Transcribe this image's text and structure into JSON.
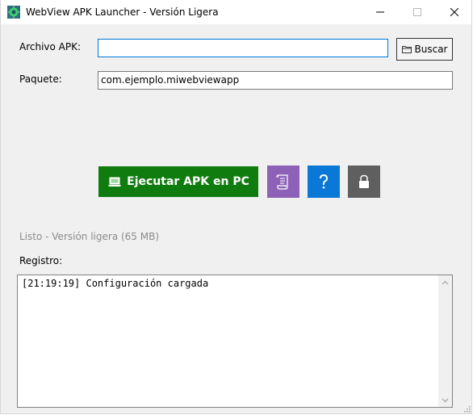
{
  "window": {
    "title": "WebView APK Launcher - Versión Ligera"
  },
  "form": {
    "apk_label": "Archivo APK:",
    "apk_value": "",
    "browse_label": "Buscar",
    "package_label": "Paquete:",
    "package_value": "com.ejemplo.miwebviewapp"
  },
  "actions": {
    "run_label": "Ejecutar APK en PC",
    "run_color": "#107c10",
    "log_button_color": "#8e61b8",
    "help_button_color": "#0a78d7",
    "lock_button_color": "#5f5f5f"
  },
  "status": {
    "text": "Listo - Versión ligera (65 MB)"
  },
  "log": {
    "label": "Registro:",
    "lines": "[21:19:19] Configuración cargada"
  },
  "icons": {
    "app": "android-icon",
    "browse": "folder-icon",
    "run": "laptop-icon",
    "log": "scroll-icon",
    "help": "question-icon",
    "lock": "lock-icon"
  }
}
